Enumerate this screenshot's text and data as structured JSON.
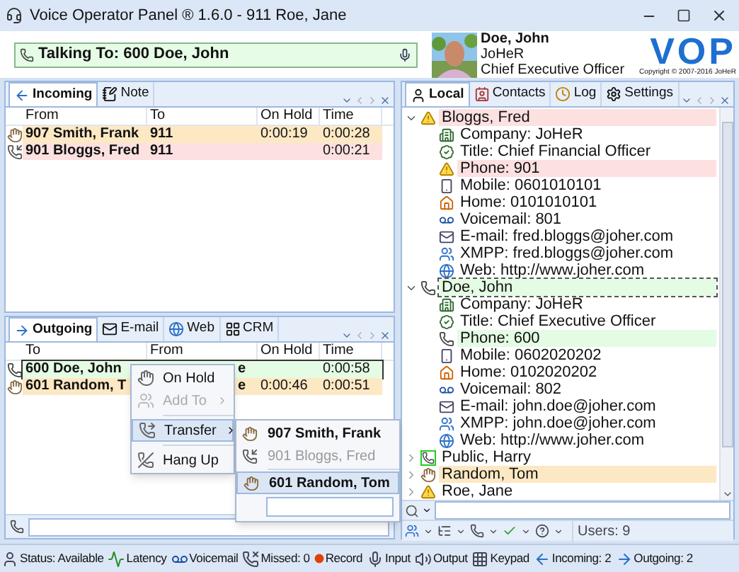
{
  "window": {
    "title": "Voice Operator Panel ® 1.6.0 - 911 Roe, Jane"
  },
  "talking_bar": {
    "text": "Talking To: 600 Doe, John"
  },
  "profile": {
    "name": "Doe, John",
    "company": "JoHeR",
    "title": "Chief Executive Officer"
  },
  "logo": {
    "text": "VOP",
    "copyright": "Copyright © 2007-2016 JoHeR"
  },
  "incoming_panel": {
    "tabs": [
      {
        "label": "Incoming",
        "kind": "incoming",
        "selected": true
      },
      {
        "label": "Note",
        "kind": "note",
        "selected": false
      }
    ],
    "columns": [
      "From",
      "To",
      "On Hold",
      "Time"
    ],
    "rows": [
      {
        "kind": "hold",
        "selected": false,
        "cells": [
          "907 Smith, Frank",
          "911",
          "0:00:19",
          "0:00:28"
        ]
      },
      {
        "kind": "ringing",
        "selected": false,
        "cells": [
          "901 Bloggs, Fred",
          "911",
          "",
          "0:00:21"
        ]
      }
    ]
  },
  "outgoing_panel": {
    "tabs": [
      {
        "label": "Outgoing",
        "kind": "outgoing",
        "selected": true
      },
      {
        "label": "E-mail",
        "kind": "email",
        "selected": false
      },
      {
        "label": "Web",
        "kind": "web",
        "selected": false
      },
      {
        "label": "CRM",
        "kind": "crm",
        "selected": false
      }
    ],
    "columns": [
      "To",
      "From",
      "On Hold",
      "Time"
    ],
    "rows": [
      {
        "kind": "talking",
        "selected": true,
        "cells": [
          "600 Doe, John",
          "e",
          "",
          "0:00:58"
        ]
      },
      {
        "kind": "hold",
        "selected": false,
        "cells": [
          "601 Random, T",
          "e",
          "0:00:46",
          "0:00:51"
        ]
      }
    ]
  },
  "context_menu": {
    "items": [
      {
        "label": "On Hold",
        "kind": "hold",
        "disabled": false,
        "has_submenu": false,
        "selected": false,
        "separator_before": false
      },
      {
        "label": "Add To",
        "kind": "conference",
        "disabled": true,
        "has_submenu": true,
        "selected": false,
        "separator_before": false
      },
      {
        "label": "Transfer",
        "kind": "transfer",
        "disabled": false,
        "has_submenu": true,
        "selected": true,
        "separator_before": true
      },
      {
        "label": "Hang Up",
        "kind": "hangup",
        "disabled": false,
        "has_submenu": false,
        "selected": false,
        "separator_before": true
      }
    ],
    "submenu": [
      {
        "label": "907 Smith, Frank",
        "kind": "hold",
        "disabled": false,
        "selected": false,
        "separator_before": false
      },
      {
        "label": "901 Bloggs, Fred",
        "kind": "ringing",
        "disabled": true,
        "selected": false,
        "separator_before": false
      },
      {
        "label": "601 Random, Tom",
        "kind": "hold",
        "disabled": false,
        "selected": true,
        "separator_before": true
      }
    ]
  },
  "contacts_panel": {
    "tabs": [
      {
        "label": "Local",
        "kind": "local",
        "selected": true
      },
      {
        "label": "Contacts",
        "kind": "contacts",
        "selected": false
      },
      {
        "label": "Log",
        "kind": "log",
        "selected": false
      },
      {
        "label": "Settings",
        "kind": "settings",
        "selected": false
      }
    ],
    "contacts": [
      {
        "name": "Bloggs, Fred",
        "kind": "warning",
        "color": "#fde0e0",
        "expanded": true,
        "focused": false,
        "children": [
          {
            "kind": "company",
            "text": "Company: JoHeR"
          },
          {
            "kind": "title",
            "text": "Title: Chief Financial Officer"
          },
          {
            "kind": "phone_warning",
            "text": "Phone: 901",
            "color": "#fde0e0"
          },
          {
            "kind": "mobile",
            "text": "Mobile: 0601010101"
          },
          {
            "kind": "home",
            "text": "Home: 0101010101"
          },
          {
            "kind": "voicemail",
            "text": "Voicemail: 801"
          },
          {
            "kind": "email",
            "text": "E-mail: fred.bloggs@joher.com"
          },
          {
            "kind": "xmpp",
            "text": "XMPP: fred.bloggs@joher.com"
          },
          {
            "kind": "web",
            "text": "Web: http://www.joher.com"
          }
        ]
      },
      {
        "name": "Doe, John",
        "kind": "talking",
        "color": "#e4fbe4",
        "expanded": true,
        "focused": true,
        "children": [
          {
            "kind": "company",
            "text": "Company: JoHeR"
          },
          {
            "kind": "title",
            "text": "Title: Chief Executive Officer"
          },
          {
            "kind": "phone_talking",
            "text": "Phone: 600",
            "color": "#e4fbe4"
          },
          {
            "kind": "mobile",
            "text": "Mobile: 0602020202"
          },
          {
            "kind": "home",
            "text": "Home: 0102020202"
          },
          {
            "kind": "voicemail",
            "text": "Voicemail: 802"
          },
          {
            "kind": "email",
            "text": "E-mail: john.doe@joher.com"
          },
          {
            "kind": "xmpp",
            "text": "XMPP: john.doe@joher.com"
          },
          {
            "kind": "web",
            "text": "Web: http://www.joher.com"
          }
        ]
      },
      {
        "name": "Public, Harry",
        "kind": "idle",
        "expanded": false,
        "focused": false
      },
      {
        "name": "Random, Tom",
        "kind": "hold",
        "color": "#fde8c4",
        "expanded": false,
        "focused": false
      },
      {
        "name": "Roe, Jane",
        "kind": "warning",
        "expanded": false,
        "focused": false
      }
    ],
    "users": "Users: 9"
  },
  "status_bar": [
    {
      "kind": "status",
      "label": "Status: Available"
    },
    {
      "kind": "latency",
      "label": "Latency"
    },
    {
      "kind": "voicemail",
      "label": "Voicemail"
    },
    {
      "kind": "missed",
      "label": "Missed: 0"
    },
    {
      "kind": "record",
      "label": "Record"
    },
    {
      "kind": "input",
      "label": "Input"
    },
    {
      "kind": "output",
      "label": "Output"
    },
    {
      "kind": "keypad",
      "label": "Keypad"
    },
    {
      "kind": "incoming",
      "label": "Incoming: 2"
    },
    {
      "kind": "outgoing",
      "label": "Outgoing: 2"
    }
  ]
}
